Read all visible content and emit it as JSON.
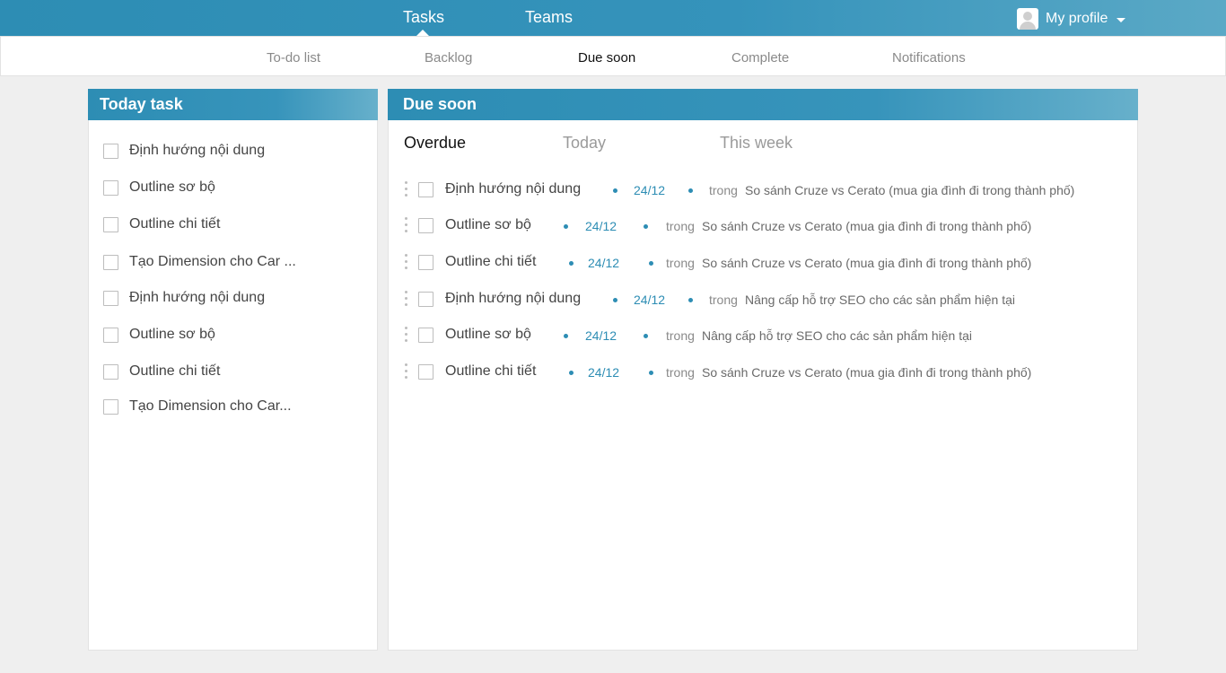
{
  "topnav": {
    "tasks": "Tasks",
    "teams": "Teams",
    "profile": "My profile"
  },
  "subnav": {
    "todo": "To-do list",
    "backlog": "Backlog",
    "due_soon": "Due soon",
    "complete": "Complete",
    "notifications": "Notifications"
  },
  "today": {
    "title": "Today task",
    "items": [
      "Định hướng nội dung",
      "Outline sơ bộ",
      "Outline chi tiết",
      "Tạo Dimension cho Car ...",
      "Định hướng nội dung",
      "Outline sơ bộ",
      "Outline chi tiết",
      "Tạo Dimension cho Car..."
    ]
  },
  "due": {
    "title": "Due soon",
    "tabs": {
      "overdue": "Overdue",
      "today": "Today",
      "week": "This week"
    },
    "in_label": "trong",
    "rows": [
      {
        "title": "Định hướng nội dung",
        "date": "24/12",
        "project": "So sánh Cruze vs Cerato (mua gia đình đi trong thành phố)"
      },
      {
        "title": "Outline sơ bộ",
        "date": "24/12",
        "project": "So sánh Cruze vs Cerato (mua gia đình đi trong thành phố)"
      },
      {
        "title": "Outline chi tiết",
        "date": "24/12",
        "project": "So sánh Cruze vs Cerato (mua gia đình đi trong thành phố)"
      },
      {
        "title": "Định hướng nội dung",
        "date": "24/12",
        "project": "Nâng cấp hỗ trợ SEO cho các sản phẩm hiện tại"
      },
      {
        "title": "Outline sơ bộ",
        "date": "24/12",
        "project": "Nâng cấp hỗ trợ SEO cho các sản phẩm hiện tại"
      },
      {
        "title": "Outline chi tiết",
        "date": "24/12",
        "project": "So sánh Cruze vs Cerato (mua gia đình đi trong thành phố)"
      }
    ]
  },
  "colors": {
    "accent": "#2d8db4",
    "background": "#efefef"
  }
}
